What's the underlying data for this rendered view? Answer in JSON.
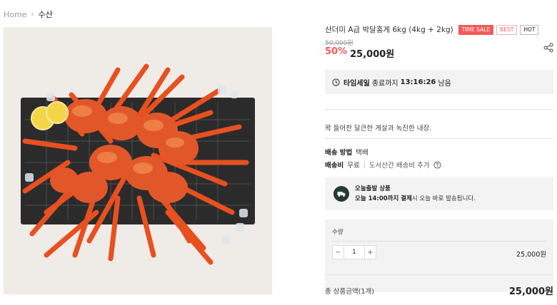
{
  "breadcrumb": {
    "home": "Home",
    "current": "수산"
  },
  "product": {
    "title": "산더미 A급 박달홍게 6kg (4kg + 2kg)",
    "badges": [
      "TIME SALE",
      "BEST",
      "HOT"
    ],
    "original_price": "50,000원",
    "discount": "50%",
    "price": "25,000원"
  },
  "timer": {
    "label": "타임세일",
    "prefix": "종료까지",
    "time": "13:16:26",
    "suffix": "남음"
  },
  "description": "꽉 들어찬 달큰한 게살과 녹진한 내장.",
  "shipping": {
    "method_label": "배송 방법",
    "method_value": "택배",
    "fee_label": "배송비",
    "fee_value": "무료",
    "extra": "도서산간 배송비 추가"
  },
  "today_ship": {
    "title": "오늘출발 상품",
    "deadline": "오늘 14:00까지 결제",
    "rest": "시 오늘 바로 발송됩니다."
  },
  "quantity": {
    "label": "수량",
    "value": "1",
    "line_price": "25,000원"
  },
  "total": {
    "label": "총 상품금액(1개)",
    "price": "25,000원"
  },
  "colors": {
    "accent": "#f25a5a",
    "truck_bg": "#263a30",
    "panel_bg": "#f3f3f3"
  },
  "icons": [
    "chevron-right-icon",
    "share-icon",
    "clock-icon",
    "help-icon",
    "truck-icon",
    "minus-icon",
    "plus-icon"
  ]
}
